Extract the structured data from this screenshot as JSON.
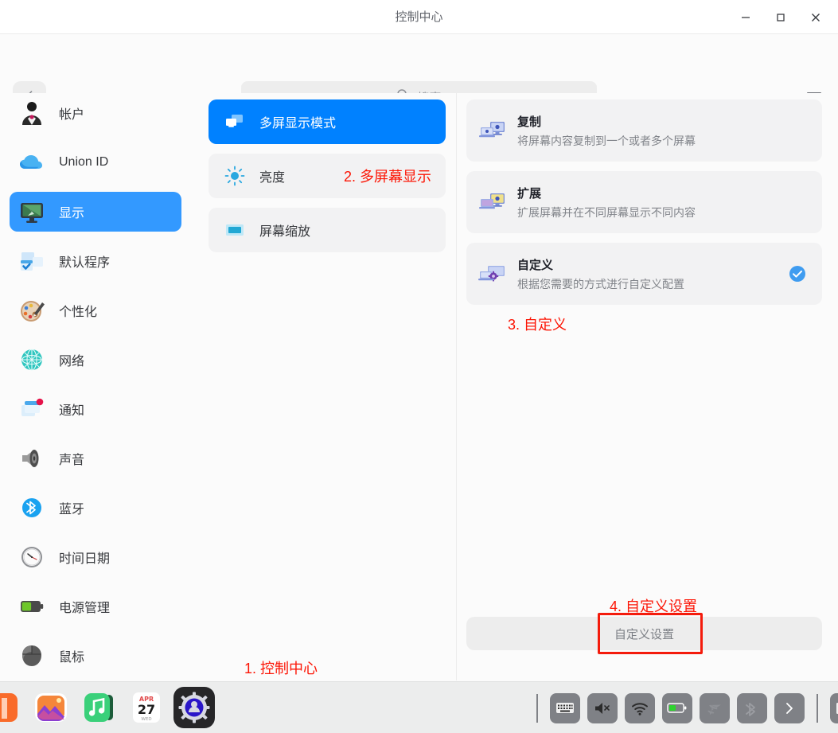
{
  "window": {
    "title": "控制中心",
    "controls": [
      {
        "name": "minimize-button",
        "glyph": "minimize"
      },
      {
        "name": "maximize-button",
        "glyph": "maximize"
      },
      {
        "name": "close-button",
        "glyph": "close"
      }
    ]
  },
  "toolbar": {
    "back_icon": "chevron-left-icon",
    "search_placeholder": "搜索",
    "search_value": "",
    "menu_icon": "hamburger-menu-icon"
  },
  "sidebar": {
    "items": [
      {
        "label": "帐户",
        "icon": "user-account-icon",
        "active": false
      },
      {
        "label": "Union ID",
        "icon": "cloud-union-id-icon",
        "active": false
      },
      {
        "label": "显示",
        "icon": "display-monitor-icon",
        "active": true
      },
      {
        "label": "默认程序",
        "icon": "default-apps-icon",
        "active": false
      },
      {
        "label": "个性化",
        "icon": "personalization-palette-icon",
        "active": false
      },
      {
        "label": "网络",
        "icon": "network-globe-icon",
        "active": false
      },
      {
        "label": "通知",
        "icon": "notification-window-icon",
        "active": false
      },
      {
        "label": "声音",
        "icon": "sound-speaker-icon",
        "active": false
      },
      {
        "label": "蓝牙",
        "icon": "bluetooth-icon",
        "active": false
      },
      {
        "label": "时间日期",
        "icon": "clock-datetime-icon",
        "active": false
      },
      {
        "label": "电源管理",
        "icon": "battery-power-icon",
        "active": false
      },
      {
        "label": "鼠标",
        "icon": "mouse-icon",
        "active": false
      }
    ]
  },
  "middle_panel": {
    "items": [
      {
        "label": "多屏显示模式",
        "icon": "multi-screen-icon",
        "active": true
      },
      {
        "label": "亮度",
        "icon": "brightness-sun-icon",
        "active": false
      },
      {
        "label": "屏幕缩放",
        "icon": "screen-scale-icon",
        "active": false
      }
    ]
  },
  "right_panel": {
    "options": [
      {
        "title": "复制",
        "desc": "将屏幕内容复制到一个或者多个屏幕",
        "icon": "duplicate-screens-icon",
        "selected": false
      },
      {
        "title": "扩展",
        "desc": "扩展屏幕并在不同屏幕显示不同内容",
        "icon": "extend-screens-icon",
        "selected": false
      },
      {
        "title": "自定义",
        "desc": "根据您需要的方式进行自定义配置",
        "icon": "custom-screens-icon",
        "selected": true
      }
    ],
    "custom_button_label": "自定义设置"
  },
  "annotations": [
    {
      "id": "anno1",
      "text": "1. 控制中心"
    },
    {
      "id": "anno2",
      "text": "2. 多屏幕显示"
    },
    {
      "id": "anno3",
      "text": "3. 自定义"
    },
    {
      "id": "anno4",
      "text": "4. 自定义设置"
    }
  ],
  "taskbar": {
    "apps": [
      {
        "name": "app-store",
        "active": false
      },
      {
        "name": "photos",
        "active": false
      },
      {
        "name": "music",
        "active": false
      },
      {
        "name": "calendar",
        "active": false,
        "month": "APR",
        "day": "27",
        "weekday": "WED"
      },
      {
        "name": "control-center",
        "active": true
      }
    ],
    "tray": [
      {
        "name": "keyboard-layout-icon"
      },
      {
        "name": "volume-muted-icon"
      },
      {
        "name": "wifi-icon"
      },
      {
        "name": "battery-icon"
      },
      {
        "name": "airplane-mode-icon"
      },
      {
        "name": "bluetooth-icon"
      },
      {
        "name": "expand-tray-icon"
      }
    ]
  },
  "colors": {
    "sidebar_selected": "#3399ff",
    "panel_selected": "#0081ff",
    "annotation": "#fc1505",
    "highlight_border": "#f41b0c",
    "check_blue": "#3f9cf0"
  }
}
